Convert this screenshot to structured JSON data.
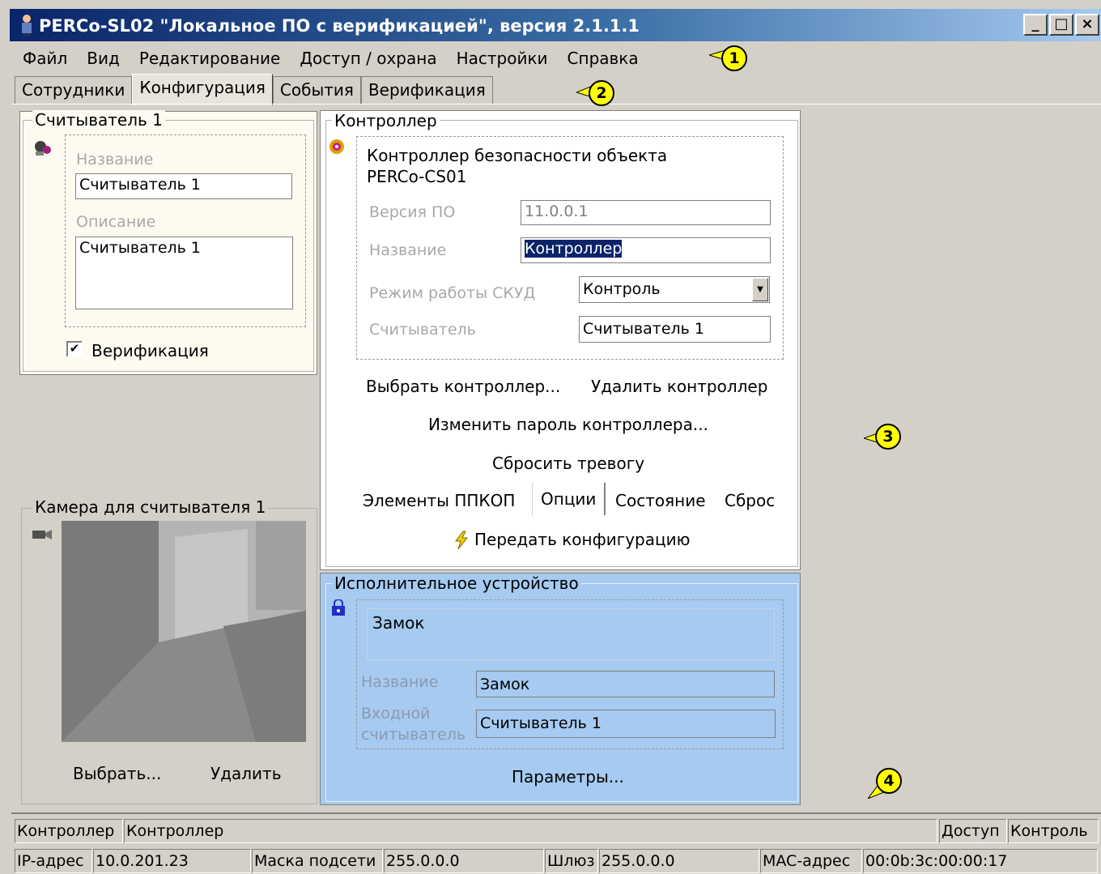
{
  "window": {
    "title": "PERCo-SL02 \"Локальное ПО с верификацией\", версия 2.1.1.1",
    "controls": [
      "_",
      "□",
      "×"
    ]
  },
  "menu": [
    "Файл",
    "Вид",
    "Редактирование",
    "Доступ / охрана",
    "Настройки",
    "Справка"
  ],
  "tabs": [
    "Сотрудники",
    "Конфигурация",
    "События",
    "Верификация"
  ],
  "active_tab": "Конфигурация",
  "reader": {
    "legend": "Считыватель 1",
    "name_label": "Название",
    "name_value": "Считыватель 1",
    "desc_label": "Описание",
    "desc_value": "Считыватель 1",
    "verification_label": "Верификация",
    "verification_checked": true
  },
  "camera": {
    "legend": "Камера для считывателя 1",
    "select_label": "Выбрать...",
    "delete_label": "Удалить"
  },
  "controller": {
    "legend": "Контроллер",
    "description": "Контроллер безопасности объекта PERCo-CS01",
    "firmware_label": "Версия ПО",
    "firmware_value": "11.0.0.1",
    "name_label": "Название",
    "name_value": "Контроллер",
    "mode_label": "Режим работы СКУД",
    "mode_value": "Контроль",
    "reader_label": "Считыватель",
    "reader_value": "Считыватель 1",
    "select_label": "Выбрать контроллер...",
    "delete_label": "Удалить контроллер",
    "change_password_label": "Изменить пароль контроллера...",
    "reset_alarm_label": "Сбросить тревогу",
    "ppkop_label": "Элементы ППКОП",
    "options_label": "Опции",
    "state_label": "Состояние",
    "reset_label": "Сброс",
    "transfer_label": "Передать конфигурацию"
  },
  "executor": {
    "legend": "Исполнительное устройство",
    "description": "Замок",
    "name_label": "Название",
    "name_value": "Замок",
    "input_reader_label_1": "Входной",
    "input_reader_label_2": "считыватель",
    "input_reader_value": "Считыватель 1",
    "params_label": "Параметры..."
  },
  "status": {
    "controller_label": "Контроллер",
    "controller_value": "Контроллер",
    "access_label": "Доступ",
    "access_value": "Контроль",
    "ip_label": "IP-адрес",
    "ip_value": "10.0.201.23",
    "mask_label": "Маска подсети",
    "mask_value": "255.0.0.0",
    "gateway_label": "Шлюз",
    "gateway_value": "255.0.0.0",
    "mac_label": "MAC-адрес",
    "mac_value": "00:0b:3c:00:00:17"
  },
  "callouts": [
    "1",
    "2",
    "3",
    "4"
  ],
  "colors": {
    "executor_bg": "#a6caf0",
    "reader_bg": "#fdfbf0",
    "callout": "#ffff00"
  }
}
